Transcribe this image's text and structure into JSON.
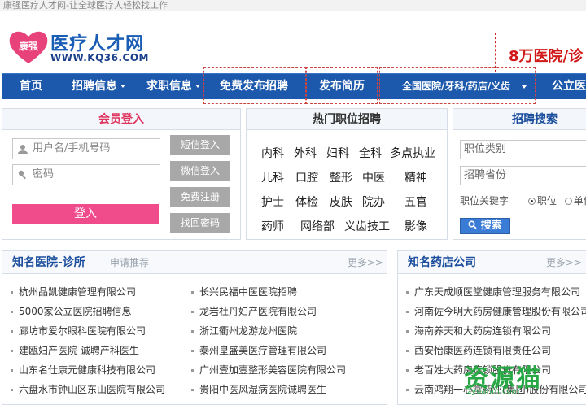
{
  "topbar": {
    "slogan": "康强医疗人才网-让全球医疗人轻松找工作"
  },
  "header": {
    "logo_name": "医疗人才网",
    "logo_url": "WWW.KQ36.COM",
    "logo_badge": "康强",
    "promo_text": "8万医院/诊"
  },
  "nav": {
    "items": [
      {
        "label": "首页"
      },
      {
        "label": "招聘信息"
      },
      {
        "label": "求职信息"
      },
      {
        "label": "免费发布招聘"
      },
      {
        "label": "发布简历"
      },
      {
        "label": "全国医院/牙科/药店/义齿"
      },
      {
        "label": "公立医院"
      }
    ]
  },
  "login": {
    "title": "会员登入",
    "username_placeholder": "用户名/手机号码",
    "password_placeholder": "密码",
    "sms_login": "短信登入",
    "wechat_login": "微信登入",
    "register": "免费注册",
    "recover": "找回密码",
    "submit": "登入"
  },
  "hot_jobs": {
    "title": "热门职位招聘",
    "rows": [
      [
        "内科",
        "外科",
        "妇科",
        "全科",
        "多点执业"
      ],
      [
        "儿科",
        "口腔",
        "整形",
        "中医",
        "精神"
      ],
      [
        "护士",
        "体检",
        "皮肤",
        "院办",
        "五官"
      ],
      [
        "药师",
        "网络部",
        "义齿技工",
        "影像"
      ]
    ]
  },
  "job_search": {
    "title": "招聘搜索",
    "category_placeholder": "职位类别",
    "province_placeholder": "招聘省份",
    "keyword_placeholder": "职位关键字",
    "radio_job": "职位",
    "radio_unit": "单位",
    "search_button": "搜索"
  },
  "hospitals": {
    "title": "知名医院-诊所",
    "apply": "申请推荐",
    "more": "更多>>",
    "col1": [
      "杭州品凯健康管理有限公司",
      "5000家公立医院招聘信息",
      "廊坊市爱尔眼科医院有限公司",
      "建瓯妇产医院 诚聘产科医生",
      "山东名仕康元健康科技有限公司",
      "六盘水市钟山区东山医院有限公司"
    ],
    "col2": [
      "长兴民福中医医院招聘",
      "龙岩杜丹妇产医院有限公司",
      "浙江衢州龙游龙州医院",
      "泰州皇盛美医疗管理有限公司",
      "广州壹加壹整形美容医院有限公司",
      "贵阳中医风湿病医院诚聘医生"
    ]
  },
  "pharmacies": {
    "title": "知名药店公司",
    "more": "更多>>",
    "items": [
      "广东天成顺医堂健康管理服务有限公司",
      "河南佐今明大药房健康管理股份有限公司",
      "海南养天和大药房连锁有限公司",
      "西安怡康医药连锁有限责任公司",
      "老百姓大药房连锁股份有限公司",
      "云南鸿翔一心堂药业(集团)股份有限公司"
    ]
  },
  "watermark": {
    "text": "资源猫",
    "sub": "zyuanm.com"
  },
  "colors": {
    "nav": "#1c58ab",
    "login_accent": "#f04c8c",
    "promo_red": "#d01818",
    "watermark": "#27a845"
  }
}
